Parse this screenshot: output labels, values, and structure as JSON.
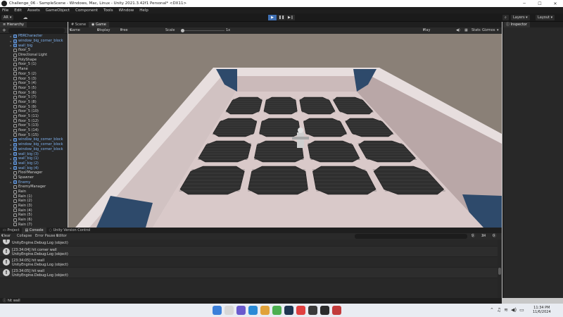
{
  "window": {
    "title": "Challenge_06 - SampleScene - Windows, Mac, Linux - Unity 2021.3.42f1 Personal* <DX11>"
  },
  "menu": [
    "File",
    "Edit",
    "Assets",
    "GameObject",
    "Component",
    "Tools",
    "Window",
    "Help"
  ],
  "toolbar": {
    "account_label": "AR",
    "layers_label": "Layers",
    "layout_label": "Layout"
  },
  "hierarchy": {
    "tab_label": "Hierarchy",
    "add_label": "+",
    "items": [
      {
        "label": "PBRCharacter",
        "arrow": "▸",
        "blue": true
      },
      {
        "label": "window_big_corner_block",
        "arrow": "▸",
        "blue": true
      },
      {
        "label": "wall_big",
        "arrow": "▸",
        "blue": true
      },
      {
        "label": "floor_5",
        "arrow": "",
        "blue": false
      },
      {
        "label": "Directional Light",
        "arrow": "",
        "blue": false
      },
      {
        "label": "PolyShape",
        "arrow": "",
        "blue": false
      },
      {
        "label": "floor_5 (1)",
        "arrow": "",
        "blue": false
      },
      {
        "label": "Plane",
        "arrow": "",
        "blue": false
      },
      {
        "label": "floor_5 (2)",
        "arrow": "",
        "blue": false
      },
      {
        "label": "floor_5 (3)",
        "arrow": "",
        "blue": false
      },
      {
        "label": "floor_5 (4)",
        "arrow": "",
        "blue": false
      },
      {
        "label": "floor_5 (5)",
        "arrow": "",
        "blue": false
      },
      {
        "label": "floor_5 (6)",
        "arrow": "",
        "blue": false
      },
      {
        "label": "floor_5 (7)",
        "arrow": "",
        "blue": false
      },
      {
        "label": "floor_5 (8)",
        "arrow": "",
        "blue": false
      },
      {
        "label": "floor_5 (9)",
        "arrow": "",
        "blue": false
      },
      {
        "label": "floor_5 (10)",
        "arrow": "",
        "blue": false
      },
      {
        "label": "floor_5 (11)",
        "arrow": "",
        "blue": false
      },
      {
        "label": "floor_5 (12)",
        "arrow": "",
        "blue": false
      },
      {
        "label": "floor_5 (13)",
        "arrow": "",
        "blue": false
      },
      {
        "label": "floor_5 (14)",
        "arrow": "",
        "blue": false
      },
      {
        "label": "floor_5 (15)",
        "arrow": "",
        "blue": false
      },
      {
        "label": "window_big_corner_block",
        "arrow": "▸",
        "blue": true
      },
      {
        "label": "window_big_corner_block",
        "arrow": "▸",
        "blue": true
      },
      {
        "label": "window_big_corner_block",
        "arrow": "▸",
        "blue": true
      },
      {
        "label": "wall_big (3)",
        "arrow": "▸",
        "blue": true
      },
      {
        "label": "wall_big (1)",
        "arrow": "▸",
        "blue": true
      },
      {
        "label": "wall_big (2)",
        "arrow": "▸",
        "blue": true
      },
      {
        "label": "wall_big (4)",
        "arrow": "▸",
        "blue": true
      },
      {
        "label": "FloorManager",
        "arrow": "",
        "blue": false
      },
      {
        "label": "Spawner",
        "arrow": "",
        "blue": false
      },
      {
        "label": "Enemy",
        "arrow": "▸",
        "blue": true
      },
      {
        "label": "EnemyManager",
        "arrow": "",
        "blue": false
      },
      {
        "label": "Rain",
        "arrow": "",
        "blue": false
      },
      {
        "label": "Rain (1)",
        "arrow": "",
        "blue": false
      },
      {
        "label": "Rain (2)",
        "arrow": "",
        "blue": false
      },
      {
        "label": "Rain (3)",
        "arrow": "",
        "blue": false
      },
      {
        "label": "Rain (4)",
        "arrow": "",
        "blue": false
      },
      {
        "label": "Rain (5)",
        "arrow": "",
        "blue": false
      },
      {
        "label": "Rain (6)",
        "arrow": "",
        "blue": false
      },
      {
        "label": "Rain (7)",
        "arrow": "",
        "blue": false
      }
    ]
  },
  "game": {
    "tabs": [
      "Scene",
      "Game"
    ],
    "active_tab": "Game",
    "mode": "Game",
    "display": "Display 1",
    "aspect": "Free Aspect",
    "scale_label": "Scale",
    "scale_value": "1x",
    "play_focused": "Play Focused",
    "stats": "Stats",
    "gizmos": "Gizmos"
  },
  "inspector": {
    "tab_label": "Inspector"
  },
  "console": {
    "tabs": [
      "Project",
      "Console",
      "Unity Version Control"
    ],
    "active_tab": "Console",
    "clear": "Clear",
    "collapse": "Collapse",
    "error_pause": "Error Pause",
    "editor": "Editor",
    "count_info": "9",
    "count_warn": "74",
    "count_error": "0",
    "rows": [
      {
        "line1": "",
        "line2": "UnityEngine.Debug:Log (object)"
      },
      {
        "line1": "[23:34:04] hit corner wall",
        "line2": "UnityEngine.Debug:Log (object)"
      },
      {
        "line1": "[23:34:05] hit wall",
        "line2": "UnityEngine.Debug:Log (object)"
      },
      {
        "line1": "[23:34:05] hit wall",
        "line2": "UnityEngine.Debug:Log (object)"
      }
    ]
  },
  "status": {
    "message": "hit wall"
  },
  "taskbar": {
    "time": "11:34 PM",
    "date": "11/6/2024"
  },
  "colors": {
    "play_active": "#3f6fb2",
    "panel_bg": "#282828",
    "wall": "#d4c3c3",
    "floor_tile": "#2f2f2f",
    "grout": "#d9c9c9",
    "ground": "#8a8077"
  }
}
